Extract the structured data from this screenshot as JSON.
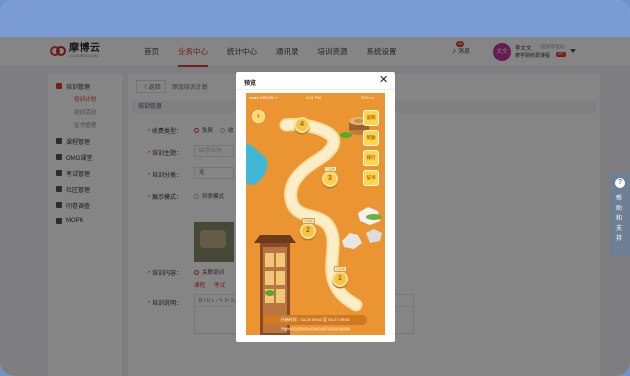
{
  "brand": {
    "name": "摩博云",
    "sub": "CO-MOBOO.COM"
  },
  "nav": [
    "首页",
    "业务中心",
    "统计中心",
    "通讯录",
    "培训资源",
    "系统设置"
  ],
  "header": {
    "messages_label": "消息",
    "messages_count": "99",
    "avatar_text": "文文",
    "user_name": "李文文",
    "user_role": "(超级管理员)",
    "user_org": "摩学院收费课程",
    "vip_label": "VIP"
  },
  "sidebar": {
    "groups": [
      {
        "label": "培训管理",
        "subs": [
          "培训计划",
          "培训活动",
          "证书管理"
        ]
      },
      {
        "label": "课程管理"
      },
      {
        "label": "OMO课堂"
      },
      {
        "label": "考试管理"
      },
      {
        "label": "社区管理"
      },
      {
        "label": "问卷调查"
      },
      {
        "label": "MOPK"
      }
    ]
  },
  "main": {
    "back_label": "〈 返回",
    "page_title": "添加培训计划",
    "section_title": "培训信息",
    "fee_label": "收费类型：",
    "fee_option_free": "免费",
    "fee_option_paid": "收",
    "topic_label": "培训主题：",
    "topic_placeholder": "50字以内",
    "category_label": "培训分类：",
    "category_value": "无",
    "display_label": "展示模式：",
    "display_option_list": "列表模式",
    "content_label": "培训内容：",
    "content_option": "关联培训",
    "link_course": "课程",
    "link_exam": "考试",
    "desc_label": "培训说明：",
    "editor_toolbar": "B I U  ≡  ⁝  ✎  X²  X₂"
  },
  "help_tab": {
    "icon": "?",
    "text": "帮助和支持"
  },
  "modal": {
    "title": "预览",
    "close": "✕",
    "status_left": "●●●● VIRGIN ᯤ",
    "status_center": "4:21 PM",
    "status_right": "22% ▭",
    "levels": [
      "1",
      "2",
      "3",
      "4"
    ],
    "level_badge": "已完成",
    "side_buttons": [
      "说明",
      "奖励",
      "排行",
      "证书"
    ],
    "time_text": "开始时间：03-25 09:00 至 03-27 09:00",
    "footer_text": "开始时间至结束时间内完成任务即可获得证书和奖励"
  }
}
